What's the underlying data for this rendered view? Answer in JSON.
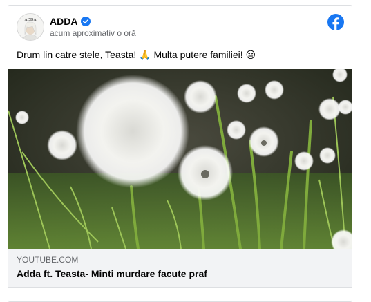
{
  "post": {
    "author": "ADDA",
    "timestamp": "acum aproximativ o oră",
    "text_main": "Drum lin catre stele, Teasta!",
    "text_emoji1": "🙏",
    "text_after": "Multa putere familiei!",
    "text_emoji2": "😔",
    "avatar_text": "ADDA",
    "verified_icon": "verified-badge-icon",
    "platform_icon": "facebook-logo-icon"
  },
  "link_preview": {
    "domain": "YOUTUBE.COM",
    "title": "Adda ft. Teasta- Minti murdare facute praf",
    "image_subject": "dandelion-seed-heads-photo"
  },
  "colors": {
    "facebook_blue": "#1877f2",
    "meta_background": "#f2f3f5",
    "secondary_text": "#65676b"
  }
}
